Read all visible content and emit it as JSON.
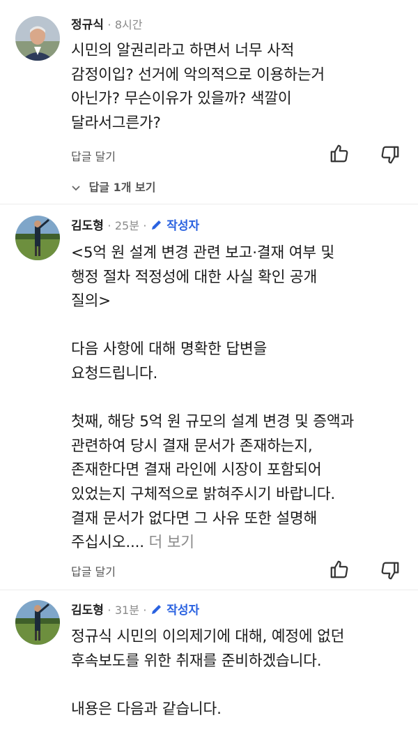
{
  "comments": [
    {
      "author": "정규식",
      "time": "8시간",
      "text": "시민의 알권리라고 하면서 너무 사적\n감정이입? 선거에 악의적으로 이용하는거\n아닌가? 무슨이유가 있을까? 색깔이\n달라서그른가?",
      "reply_label": "답글 달기",
      "view_replies_label": "답글 1개 보기"
    },
    {
      "author": "김도형",
      "time": "25분",
      "badge": "작성자",
      "text": "<5억 원 설계 변경 관련 보고·결재 여부 및\n행정 절차 적정성에 대한 사실 확인 공개\n질의>\n\n다음 사항에 대해 명확한 답변을\n요청드립니다.\n\n첫째, 해당 5억 원 규모의 설계 변경 및 증액과\n관련하여 당시 결재 문서가 존재하는지,\n존재한다면 결재 라인에 시장이 포함되어\n있었는지 구체적으로 밝혀주시기 바랍니다.\n결재 문서가 없다면 그 사유 또한 설명해\n주십시오.... ",
      "more_label": "더 보기",
      "reply_label": "답글 달기"
    },
    {
      "author": "김도형",
      "time": "31분",
      "badge": "작성자",
      "text": "정규식 시민의 이의제기에 대해, 예정에 없던\n후속보도를 위한 취재를 준비하겠습니다.\n\n내용은 다음과 같습니다."
    }
  ],
  "separator": "·",
  "colors": {
    "author_badge": "#2a62e0",
    "muted": "#8a8a8a"
  },
  "icons": [
    "pencil-icon",
    "thumbs-up-icon",
    "thumbs-down-icon",
    "chevron-down-icon"
  ]
}
